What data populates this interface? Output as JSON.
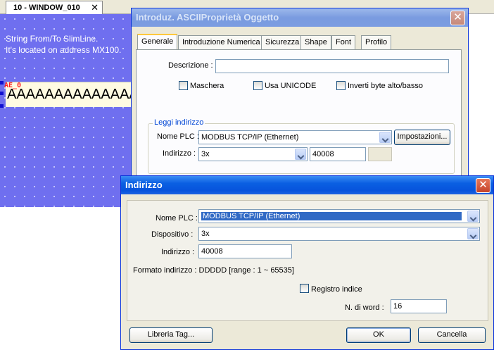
{
  "editor": {
    "doc_tab_label": "10 - WINDOW_010",
    "canvas_line1": "String From/To SlimLine.",
    "canvas_line2": "It's located on address MX100.",
    "ae_label": "AE_0",
    "ae_value": "AAAAAAAAAAAAAAAAA"
  },
  "props_dialog": {
    "title": "Introduz. ASCIIProprietà Oggetto",
    "tabs": [
      "Generale",
      "Introduzione Numerica",
      "Sicurezza",
      "Shape",
      "Font",
      "Profilo"
    ],
    "descrizione_label": "Descrizione :",
    "descrizione_value": "",
    "checkboxes": [
      "Maschera",
      "Usa UNICODE",
      "Inverti byte alto/basso"
    ],
    "group_title": "Leggi indirizzo",
    "nome_plc_label": "Nome PLC :",
    "nome_plc_value": "MODBUS TCP/IP (Ethernet)",
    "impostazioni_label": "Impostazioni...",
    "indirizzo_label": "Indirizzo :",
    "indirizzo_type": "3x",
    "indirizzo_value": "40008"
  },
  "addr_dialog": {
    "title": "Indirizzo",
    "nome_plc_label": "Nome PLC :",
    "nome_plc_value": "MODBUS TCP/IP (Ethernet)",
    "dispositivo_label": "Dispositivo :",
    "dispositivo_value": "3x",
    "indirizzo_label": "Indirizzo :",
    "indirizzo_value": "40008",
    "formato_text": "Formato indirizzo : DDDDD [range : 1 ~ 65535]",
    "registro_label": "Registro indice",
    "nword_label": "N. di word :",
    "nword_value": "16",
    "libreria_label": "Libreria Tag...",
    "ok_label": "OK",
    "cancel_label": "Cancella"
  },
  "colors": {
    "canvas": "#6f6fef",
    "title_active": "#0754dc",
    "selection": "#316ac5",
    "ae_label": "#ff2020"
  }
}
